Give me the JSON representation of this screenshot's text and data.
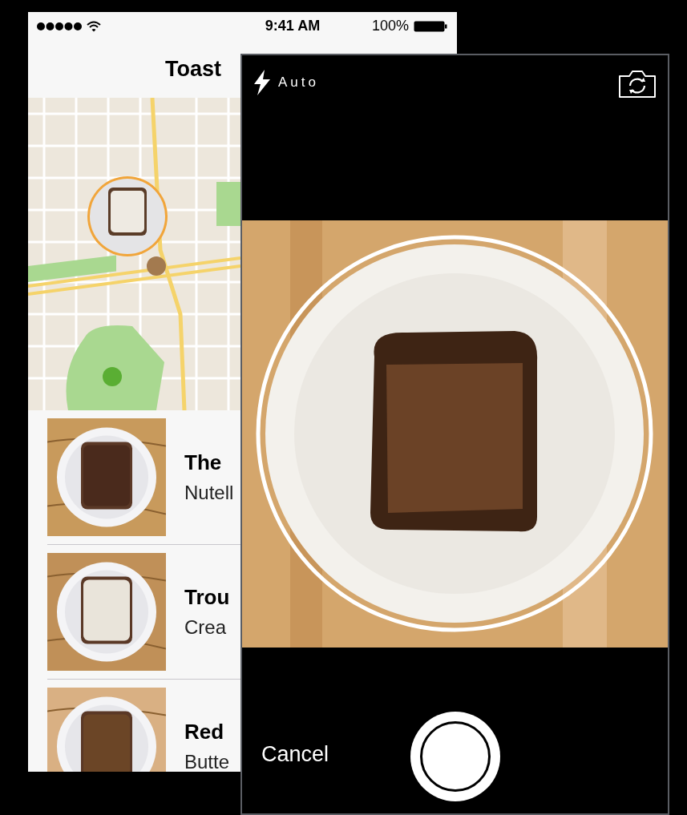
{
  "status_bar": {
    "time": "9:41 AM",
    "battery": "100%"
  },
  "nav": {
    "title": "Toast"
  },
  "list": [
    {
      "title": "The",
      "subtitle": "Nutell"
    },
    {
      "title": "Trou",
      "subtitle": "Crea"
    },
    {
      "title": "Red",
      "subtitle": "Butte"
    }
  ],
  "camera": {
    "flash": "Auto",
    "cancel": "Cancel"
  }
}
